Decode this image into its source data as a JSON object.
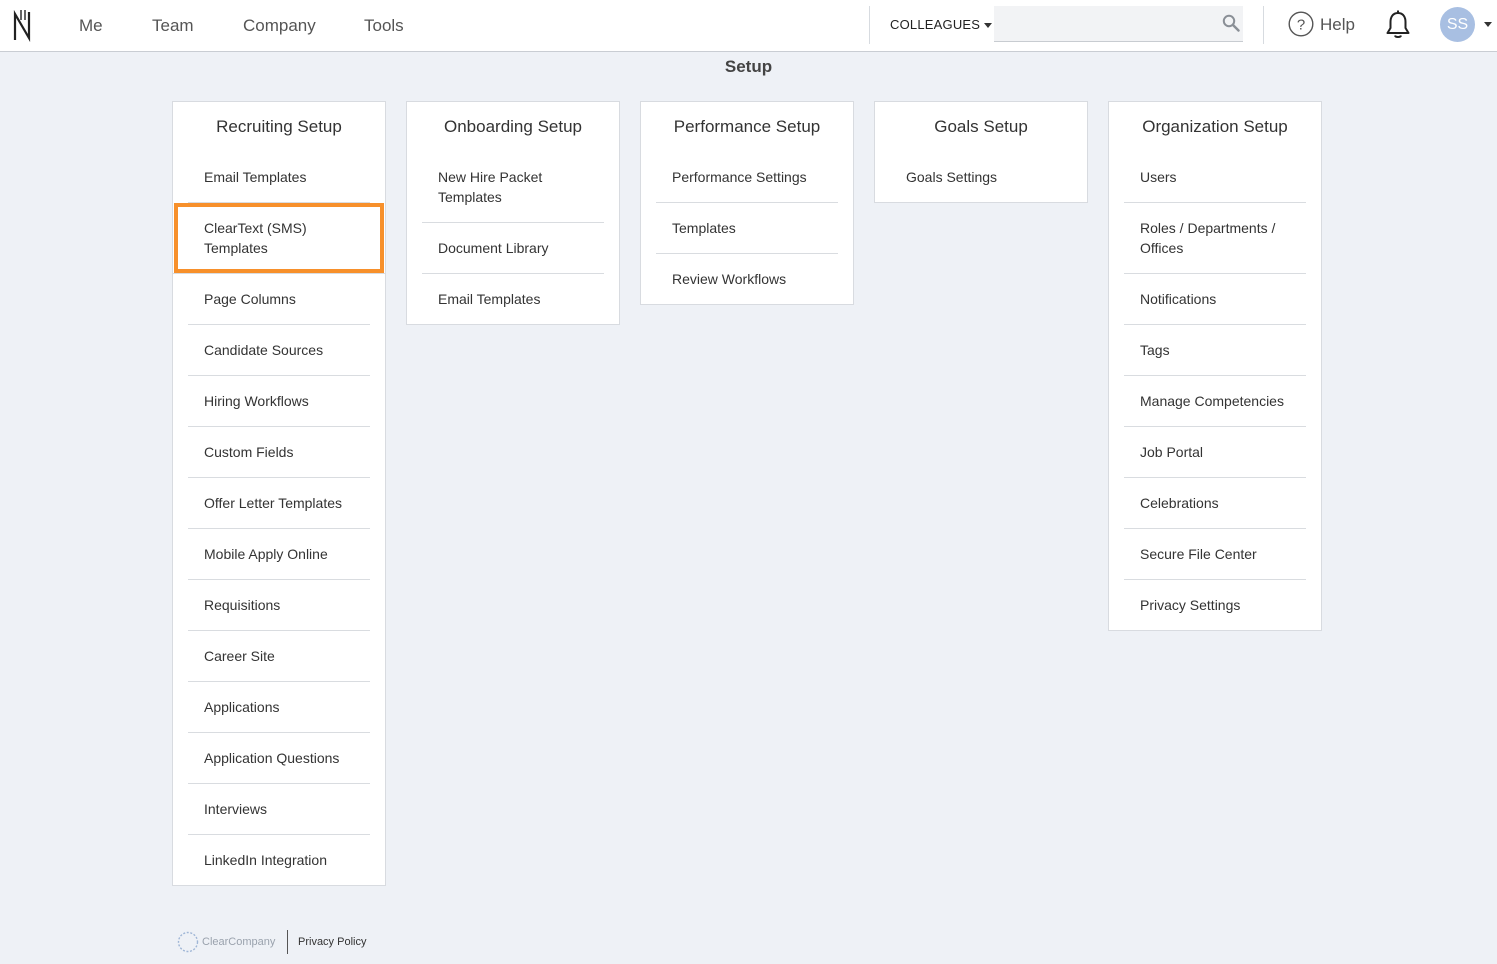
{
  "nav": {
    "me": "Me",
    "team": "Team",
    "company": "Company",
    "tools": "Tools",
    "colleagues": "COLLEAGUES",
    "search_value": "",
    "help": "Help",
    "avatar_initials": "SS"
  },
  "page": {
    "title": "Setup"
  },
  "cards": [
    {
      "title": "Recruiting Setup",
      "items": [
        "Email Templates",
        "ClearText (SMS) Templates",
        "Page Columns",
        "Candidate Sources",
        "Hiring Workflows",
        "Custom Fields",
        "Offer Letter Templates",
        "Mobile Apply Online",
        "Requisitions",
        "Career Site",
        "Applications",
        "Application Questions",
        "Interviews",
        "LinkedIn Integration"
      ]
    },
    {
      "title": "Onboarding Setup",
      "items": [
        "New Hire Packet Templates",
        "Document Library",
        "Email Templates"
      ]
    },
    {
      "title": "Performance Setup",
      "items": [
        "Performance Settings",
        "Templates",
        "Review Workflows"
      ]
    },
    {
      "title": "Goals Setup",
      "items": [
        "Goals Settings"
      ]
    },
    {
      "title": "Organization Setup",
      "items": [
        "Users",
        "Roles / Departments / Offices",
        "Notifications",
        "Tags",
        "Manage Competencies",
        "Job Portal",
        "Celebrations",
        "Secure File Center",
        "Privacy Settings"
      ]
    }
  ],
  "footer": {
    "brand": "ClearCompany",
    "privacy": "Privacy Policy"
  },
  "colors": {
    "highlight": "#f7902b",
    "background": "#eef1f6",
    "avatar": "#a8bfe2"
  }
}
